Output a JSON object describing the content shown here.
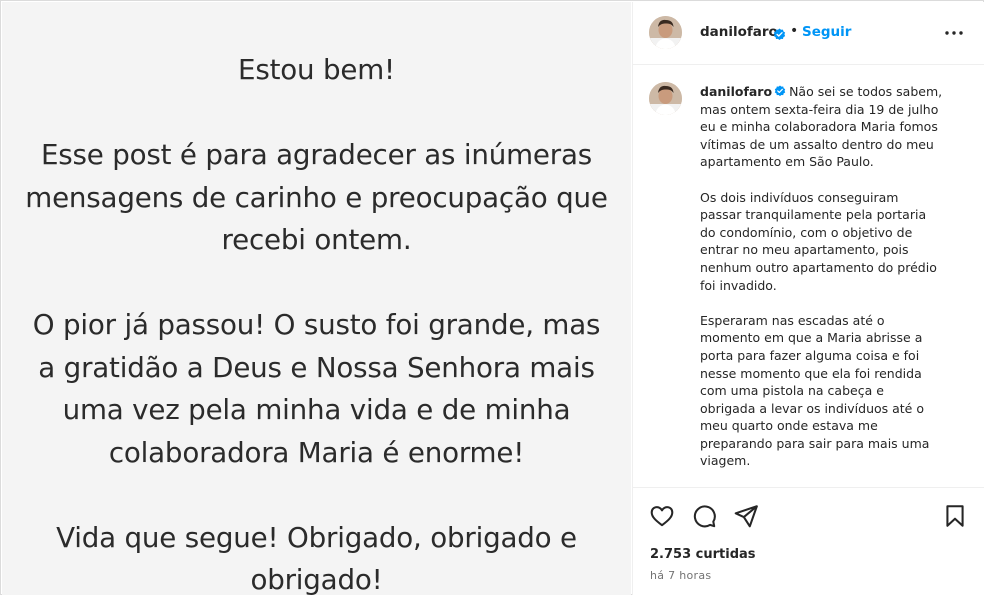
{
  "post_image": {
    "lines": [
      "Estou bem!",
      "",
      "Esse post é para agradecer as inúmeras",
      "mensagens de carinho e preocupação que",
      "recebi ontem.",
      "",
      "O pior já passou! O susto foi grande, mas",
      "a gratidão a Deus e Nossa Senhora mais",
      "uma vez pela minha vida e de minha",
      "colaboradora Maria é enorme!",
      "",
      "Vida que segue! Obrigado, obrigado e",
      "obrigado!"
    ]
  },
  "header": {
    "username": "danilofaro",
    "separator": "•",
    "follow_label": "Seguir",
    "more_icon": "more-horizontal-icon"
  },
  "caption": {
    "username": "danilofaro",
    "paragraphs": [
      [
        "Não sei se todos sabem,",
        "mas ontem sexta-feira dia 19 de julho",
        "eu e minha colaboradora Maria fomos",
        "vítimas de um assalto dentro do meu",
        "apartamento em São Paulo."
      ],
      [
        "Os dois indivíduos conseguiram",
        "passar tranquilamente pela portaria",
        "do condomínio, com o objetivo de",
        "entrar no meu apartamento, pois",
        "nenhum outro apartamento do prédio",
        "foi invadido."
      ],
      [
        "Esperaram nas escadas até o",
        "momento em que a Maria abrisse a",
        "porta para fazer alguma coisa e foi",
        "nesse momento que ela foi rendida",
        "com uma pistola na cabeça e",
        "obrigada a levar os indivíduos até o",
        "meu quarto onde estava me",
        "preparando para sair para mais uma",
        "viagem."
      ]
    ]
  },
  "actions": {
    "icons": [
      "heart-icon",
      "comment-icon",
      "share-icon",
      "bookmark-icon"
    ],
    "likes": "2.753 curtidas",
    "time": "há 7 horas"
  },
  "colors": {
    "accent": "#0095f6",
    "verified": "#0095f6",
    "text": "#262626",
    "muted": "#737373",
    "post_bg": "#f4f4f4"
  }
}
